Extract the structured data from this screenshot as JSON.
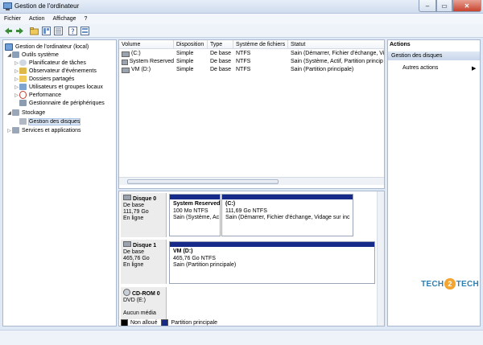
{
  "window": {
    "title": "Gestion de l'ordinateur",
    "min": "–",
    "max": "▭",
    "close": "✕"
  },
  "menu": [
    "Fichier",
    "Action",
    "Affichage",
    "?"
  ],
  "tree": {
    "root": "Gestion de l'ordinateur (local)",
    "tools": "Outils système",
    "tools_items": [
      "Planificateur de tâches",
      "Observateur d'événements",
      "Dossiers partagés",
      "Utilisateurs et groupes locaux",
      "Performance",
      "Gestionnaire de périphériques"
    ],
    "storage": "Stockage",
    "disk_mgmt": "Gestion des disques",
    "services": "Services et applications"
  },
  "volumes": {
    "headers": [
      "Volume",
      "Disposition",
      "Type",
      "Système de fichiers",
      "Statut"
    ],
    "rows": [
      [
        "(C:)",
        "Simple",
        "De base",
        "NTFS",
        "Sain (Démarrer, Fichier d'échange, Vid"
      ],
      [
        "System Reserved",
        "Simple",
        "De base",
        "NTFS",
        "Sain (Système, Actif, Partition princip"
      ],
      [
        "VM (D:)",
        "Simple",
        "De base",
        "NTFS",
        "Sain (Partition principale)"
      ]
    ]
  },
  "disks": [
    {
      "name": "Disque 0",
      "type": "De base",
      "size": "111,79 Go",
      "state": "En ligne",
      "parts": [
        {
          "title": "System Reserved",
          "size": "100 Mo NTFS",
          "status": "Sain (Système, Ac"
        },
        {
          "title": "(C:)",
          "size": "111,69 Go NTFS",
          "status": "Sain (Démarrer, Fichier d'échange, Vidage sur inc"
        }
      ]
    },
    {
      "name": "Disque 1",
      "type": "De base",
      "size": "465,76 Go",
      "state": "En ligne",
      "parts": [
        {
          "title": "VM  (D:)",
          "size": "465,76 Go NTFS",
          "status": "Sain (Partition principale)"
        }
      ]
    },
    {
      "name": "CD-ROM 0",
      "type": "DVD (E:)",
      "state": "Aucun média"
    }
  ],
  "legend": {
    "unalloc": "Non alloué",
    "primary": "Partition principale",
    "unalloc_color": "#000000",
    "primary_color": "#162a8a"
  },
  "actions": {
    "title": "Actions",
    "section": "Gestion des disques",
    "more": "Autres actions"
  },
  "watermark": {
    "left": "TECH",
    "mid": "2",
    "right": "TECH"
  }
}
